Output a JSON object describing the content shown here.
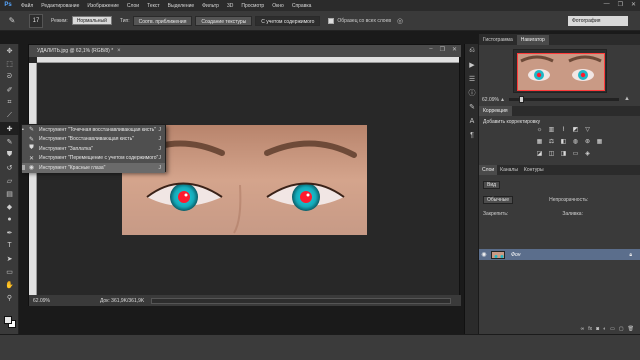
{
  "app": {
    "logo": "Ps"
  },
  "menubar": {
    "items": [
      "Файл",
      "Редактирование",
      "Изображение",
      "Слои",
      "Текст",
      "Выделение",
      "Фильтр",
      "3D",
      "Просмотр",
      "Окно",
      "Справка"
    ],
    "window_controls": [
      "—",
      "❐",
      "✕"
    ]
  },
  "options": {
    "tool_icon": "healing-brush-icon",
    "brush_size": "17",
    "mode_label": "Режим:",
    "mode_value": "Нормальный",
    "type_label": "Тип:",
    "type_buttons": [
      "Соотв. приближения",
      "Создание текстуры",
      "С учетом содержимого"
    ],
    "sample_all_layers": "Образец со всех слоев",
    "workspace": "Фотография"
  },
  "toolbar": {
    "tools": [
      "move",
      "marquee",
      "lasso",
      "quick-select",
      "crop",
      "eyedropper",
      "healing",
      "brush",
      "stamp",
      "history-brush",
      "eraser",
      "gradient",
      "blur",
      "dodge",
      "pen",
      "type",
      "path-select",
      "shape",
      "hand",
      "zoom"
    ]
  },
  "document": {
    "title": "УДАЛИТЬ.jpg @ 62,1% (RGB/8) *",
    "status_zoom": "62.09%",
    "status_doc": "Док: 361,9K/361,9K"
  },
  "flyout": {
    "items": [
      {
        "label": "Инструмент \"Точечная восстанавливающая кисть\"",
        "key": "J"
      },
      {
        "label": "Инструмент \"Восстанавливающая кисть\"",
        "key": "J"
      },
      {
        "label": "Инструмент \"Заплатка\"",
        "key": "J"
      },
      {
        "label": "Инструмент \"Перемещение с учетом содержимого\"",
        "key": "J"
      },
      {
        "label": "Инструмент \"Красные глаза\"",
        "key": "J"
      }
    ]
  },
  "navigator": {
    "tabs": [
      "Гистограмма",
      "Навигатор"
    ],
    "zoom": "62.09%",
    "frame_color": "#ff3b3b"
  },
  "adjustments": {
    "tab": "Коррекция",
    "title": "Добавить корректировку"
  },
  "layers": {
    "tabs": [
      "Слои",
      "Каналы",
      "Контуры"
    ],
    "filter_label": "Вид",
    "blend_mode": "Обычные",
    "opacity_label": "Непрозрачность:",
    "lock_label": "Закрепить:",
    "fill_label": "Заливка:",
    "layer_name": "Фон"
  },
  "colors": {
    "accent": "#5b6e8c",
    "eye_red": "#ff1a2e",
    "eye_cyan": "#22c6d6"
  }
}
